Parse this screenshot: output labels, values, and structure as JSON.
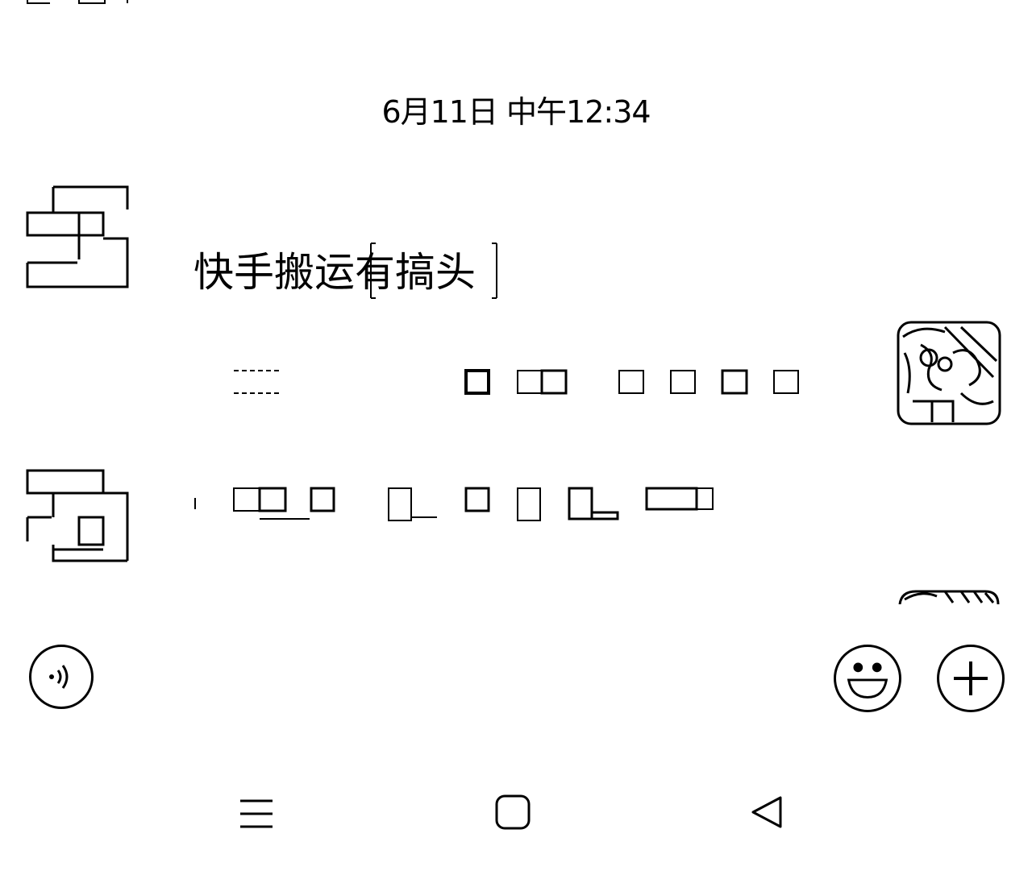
{
  "chat": {
    "timestamp": "6月11日 中午12:34",
    "messages": [
      {
        "side": "left",
        "avatar": "sender-avatar-icon",
        "text": "快手搬运有搞头"
      },
      {
        "side": "right",
        "avatar": "user-avatar-icon",
        "text": ""
      },
      {
        "side": "left",
        "avatar": "sender-avatar-icon",
        "text": ""
      },
      {
        "side": "right",
        "avatar": "user-avatar-icon",
        "text": ""
      }
    ]
  },
  "input_bar": {
    "voice_icon": "voice-icon",
    "emoji_icon": "emoji-icon",
    "add_icon": "plus-icon"
  },
  "nav_bar": {
    "menu_icon": "menu-icon",
    "home_icon": "home-icon",
    "back_icon": "back-icon"
  }
}
